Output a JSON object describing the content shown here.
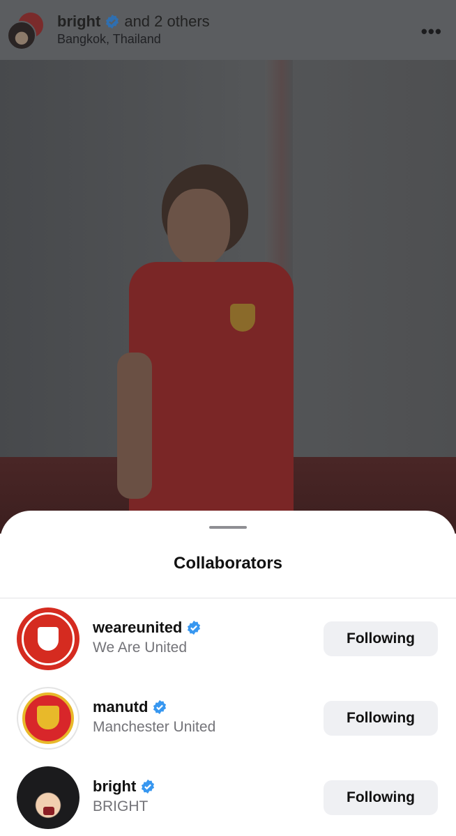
{
  "post": {
    "username": "bright",
    "others_text": "and 2 others",
    "location": "Bangkok, Thailand",
    "more_icon": "•••"
  },
  "sheet": {
    "title": "Collaborators"
  },
  "collaborators": [
    {
      "username": "weareunited",
      "display_name": "We Are United",
      "button_label": "Following",
      "verified": true
    },
    {
      "username": "manutd",
      "display_name": "Manchester United",
      "button_label": "Following",
      "verified": true
    },
    {
      "username": "bright",
      "display_name": "BRIGHT",
      "button_label": "Following",
      "verified": true
    }
  ],
  "colors": {
    "verified_blue": "#3797f0",
    "button_bg": "#eff0f3"
  }
}
